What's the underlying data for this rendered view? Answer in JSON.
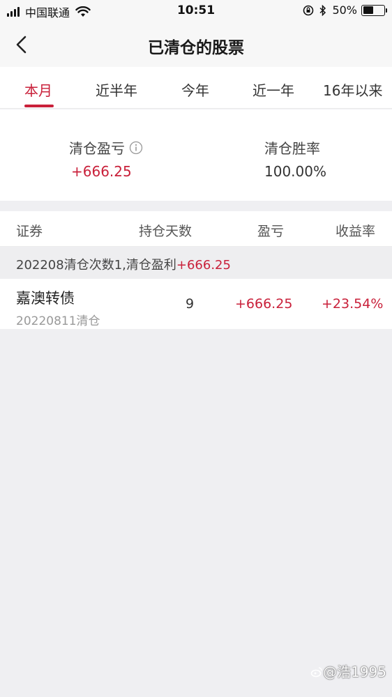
{
  "status_bar": {
    "carrier": "中国联通",
    "time": "10:51",
    "battery": "50%",
    "battery_level": 0.5
  },
  "nav": {
    "title": "已清仓的股票"
  },
  "tabs": [
    {
      "label": "本月",
      "active": true
    },
    {
      "label": "近半年",
      "active": false
    },
    {
      "label": "今年",
      "active": false
    },
    {
      "label": "近一年",
      "active": false
    },
    {
      "label": "16年以来",
      "active": false
    }
  ],
  "summary": {
    "pnl_label": "清仓盈亏",
    "pnl_value": "+666.25",
    "win_rate_label": "清仓胜率",
    "win_rate_value": "100.00%"
  },
  "table": {
    "columns": [
      "证券",
      "持仓天数",
      "盈亏",
      "收益率"
    ],
    "groups": [
      {
        "header_prefix": "202208清仓次数1,清仓盈利",
        "header_value": "+666.25",
        "rows": [
          {
            "name": "嘉澳转债",
            "date": "20220811清仓",
            "days": "9",
            "pnl": "+666.25",
            "return": "+23.54%"
          }
        ]
      }
    ]
  },
  "watermark": "@浩1995",
  "colors": {
    "accent": "#c9203a",
    "background": "#efeff2"
  }
}
